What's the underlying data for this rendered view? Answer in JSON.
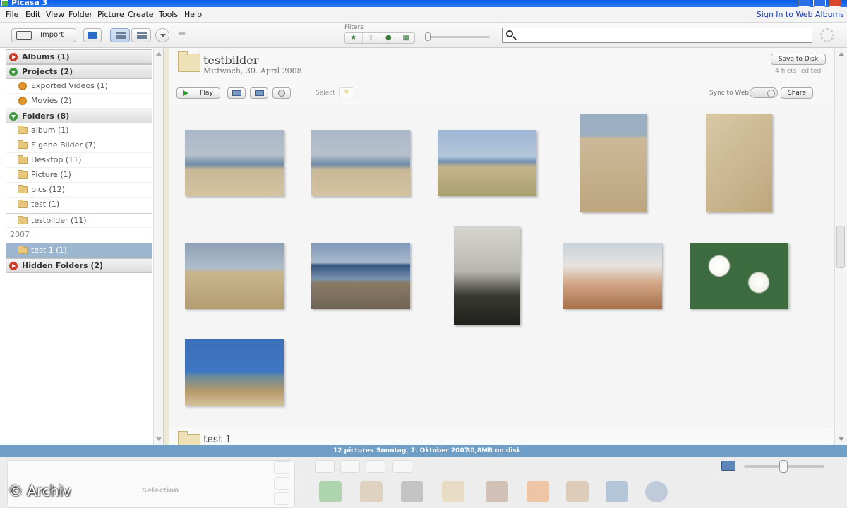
{
  "window": {
    "title": "Picasa 3"
  },
  "menu": [
    "File",
    "Edit",
    "View",
    "Folder",
    "Picture",
    "Create",
    "Tools",
    "Help"
  ],
  "signin": "Sign In to Web Albums",
  "toolbar": {
    "import_label": "Import",
    "filters_label": "Filters",
    "search_placeholder": ""
  },
  "sidebar": {
    "albums": "Albums (1)",
    "projects": "Projects (2)",
    "project_items": [
      "Exported Videos (1)",
      "Movies (2)"
    ],
    "folders": "Folders (8)",
    "folder_items": [
      "album (1)",
      "Eigene Bilder (7)",
      "Desktop (11)",
      "Picture (1)",
      "pics (12)",
      "test (1)",
      "testbilder (11)"
    ],
    "year": "2007",
    "year_items": [
      "test 1 (1)"
    ],
    "hidden": "Hidden Folders (2)"
  },
  "content": {
    "folder_title": "testbilder",
    "folder_date": "Mittwoch, 30. April 2008",
    "save_label": "Save to Disk",
    "edited": "4 file(s) edited",
    "play_label": "Play",
    "select_label": "Select",
    "sync_label": "Sync to Web",
    "share_label": "Share",
    "next_folder_title": "test 1"
  },
  "status": {
    "pictures": "12 pictures",
    "date": "Sonntag, 7. Oktober 2007",
    "size": "30,8MB on disk"
  },
  "tray": {
    "selection_label": "Selection"
  },
  "watermark": "© Archiv",
  "colors": {
    "statusbar": "#6f9ec7",
    "selected_row": "#9db6cf",
    "titlebar": "#0a5ce6"
  }
}
